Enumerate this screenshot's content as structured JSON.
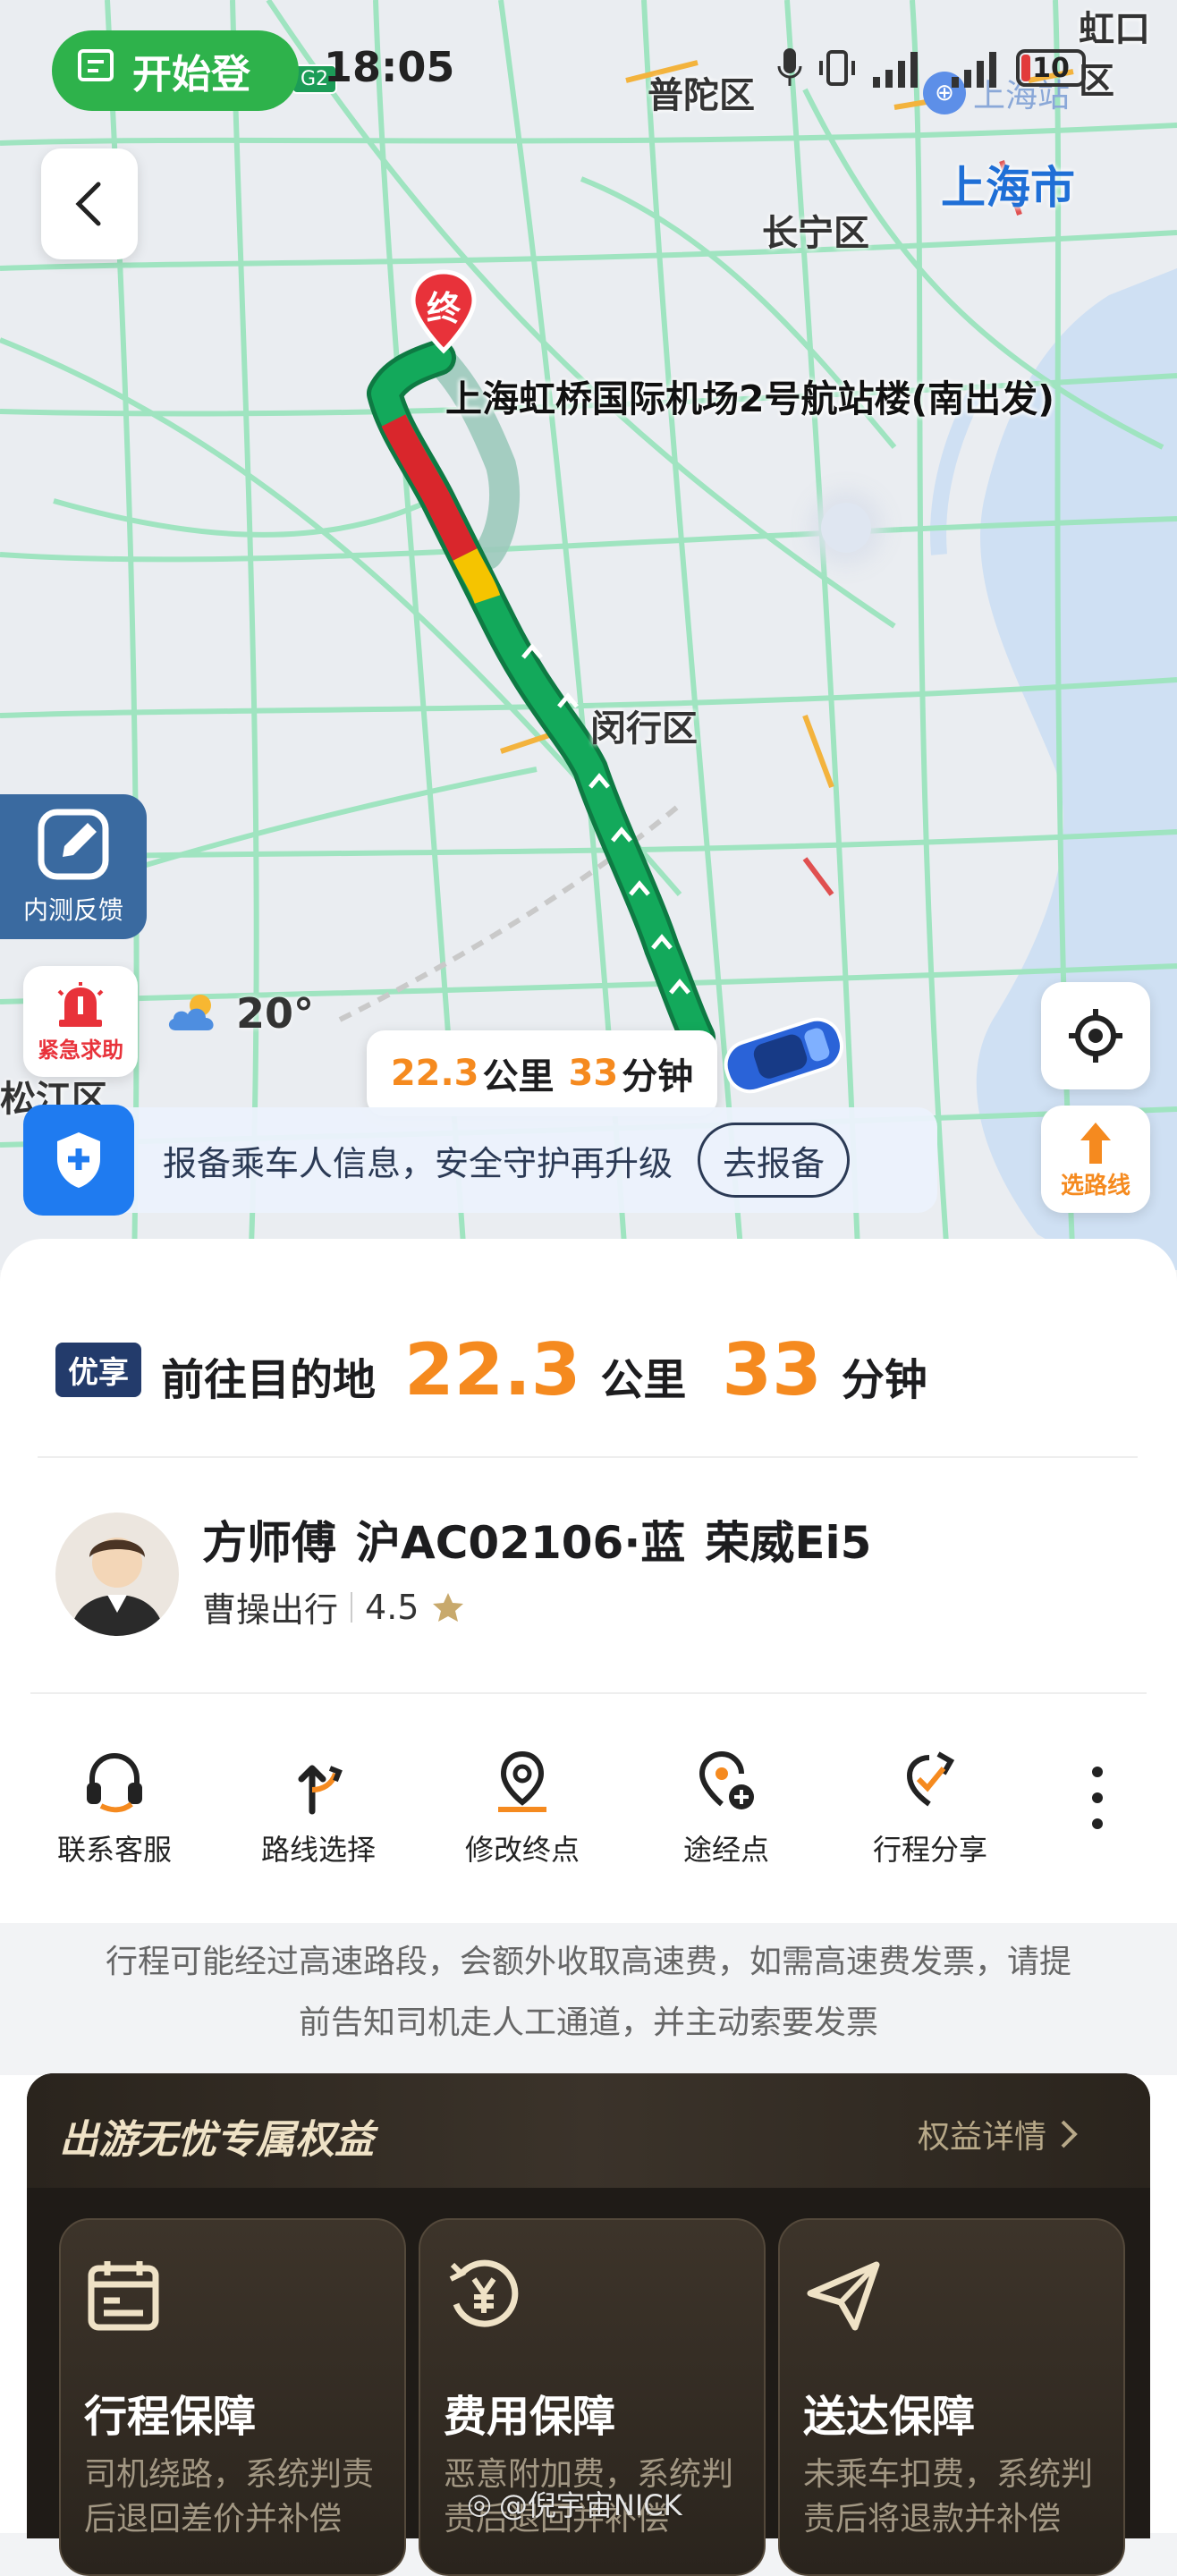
{
  "status_bar": {
    "time": "18:05",
    "battery": "10",
    "record_pill_label": "开始登"
  },
  "map": {
    "districts": {
      "putuo": "普陀区",
      "changning": "长宁区",
      "shanghai_city": "上海市",
      "minhang": "闵行区",
      "songjiang": "松江区",
      "hongkou": "虹口区",
      "shanghai_station": "上海站"
    },
    "road_badge": "G2",
    "end_marker": "终",
    "destination": "上海虹桥国际机场2号航站楼(南出发)",
    "weather_temp": "20°",
    "route_distance": "22.3",
    "route_distance_unit": "公里",
    "route_time": "33",
    "route_time_unit": "分钟",
    "feedback_label": "内测反馈",
    "sos_label": "紧急求助",
    "route_select_label": "选路线",
    "safety_banner_text": "报备乘车人信息，安全守护再升级",
    "safety_banner_button": "去报备"
  },
  "trip": {
    "badge": "优享",
    "heading": "前往目的地",
    "distance": "22.3",
    "distance_unit": "公里",
    "time": "33",
    "time_unit": "分钟"
  },
  "driver": {
    "name": "方师傅",
    "plate": "沪AC02106·蓝",
    "car": "荣威Ei5",
    "company": "曹操出行",
    "rating": "4.5"
  },
  "actions": [
    {
      "label": "联系客服",
      "icon": "headset-icon"
    },
    {
      "label": "路线选择",
      "icon": "route-fork-icon"
    },
    {
      "label": "修改终点",
      "icon": "location-pin-icon"
    },
    {
      "label": "途经点",
      "icon": "waypoint-add-icon"
    },
    {
      "label": "行程分享",
      "icon": "share-icon"
    }
  ],
  "notice": {
    "line1": "行程可能经过高速路段，会额外收取高速费，如需高速费发票，请提",
    "line2": "前告知司机走人工通道，并主动索要发票"
  },
  "benefits": {
    "title": "出游无忧专属权益",
    "details_link": "权益详情",
    "cards": [
      {
        "title": "行程保障",
        "desc1": "司机绕路，系统判责",
        "desc2": "后退回差价并补偿",
        "icon": "itinerary-icon"
      },
      {
        "title": "费用保障",
        "desc1": "恶意附加费，系统判",
        "desc2": "责后退回并补偿",
        "icon": "yuan-refund-icon"
      },
      {
        "title": "送达保障",
        "desc1": "未乘车扣费，系统判",
        "desc2": "责后将退款并补偿",
        "icon": "paper-plane-icon"
      }
    ]
  },
  "watermark": "@倪宇宙NICK",
  "colors": {
    "route_green": "#13a95b",
    "route_red": "#d9262c",
    "route_yellow": "#f5c400",
    "accent_orange": "#f58a1f",
    "pill_green": "#2eb24b",
    "safety_blue": "#1f7bf0"
  }
}
